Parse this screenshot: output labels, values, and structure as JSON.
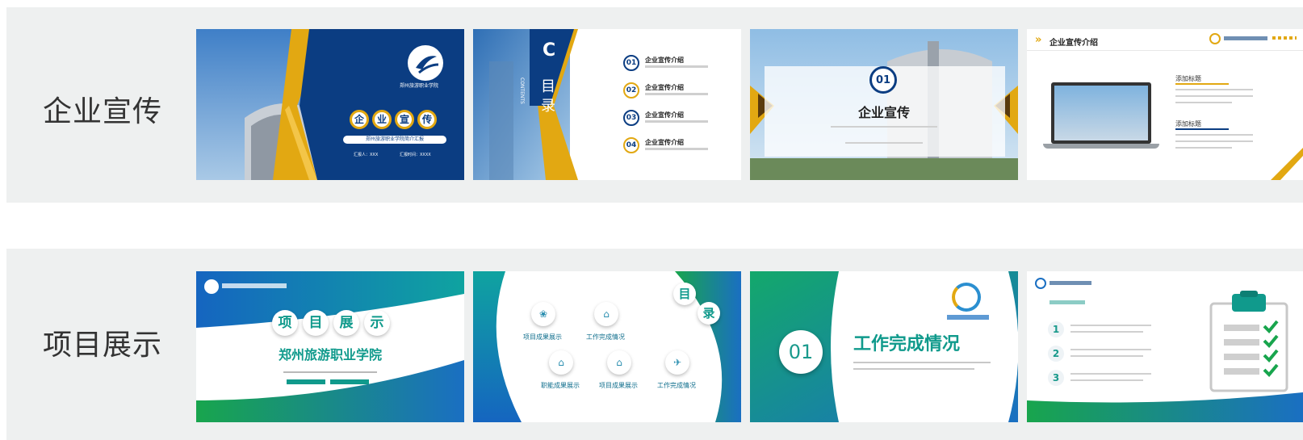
{
  "rows": [
    {
      "label": "企业宣传",
      "thumbs": {
        "t1": {
          "badge": [
            "企",
            "业",
            "宣",
            "传"
          ],
          "subtitle": "郑州旅游职业学院简介汇报",
          "reporter": "汇报人：XXX",
          "date": "汇报时间：XXXX"
        },
        "t2": {
          "side_title": "目录",
          "side_letter": "C",
          "side_word": "CONTENTS",
          "items": [
            {
              "num": "01",
              "title": "企业宣传介绍"
            },
            {
              "num": "02",
              "title": "企业宣传介绍"
            },
            {
              "num": "03",
              "title": "企业宣传介绍"
            },
            {
              "num": "04",
              "title": "企业宣传介绍"
            }
          ]
        },
        "t3": {
          "num": "01",
          "title": "企业宣传"
        },
        "t4": {
          "header": "企业宣传介绍",
          "section1": "添加标题",
          "section2": "添加标题"
        }
      }
    },
    {
      "label": "项目展示",
      "thumbs": {
        "t1": {
          "badge": [
            "项",
            "目",
            "展",
            "示"
          ],
          "title": "郑州旅游职业学院"
        },
        "t2": {
          "title_chars": [
            "目",
            "录"
          ],
          "items": [
            {
              "icon": "❀",
              "label": "项目成果展示"
            },
            {
              "icon": "⌂",
              "label": "工作完成情况"
            },
            {
              "icon": "⌂",
              "label": "职能成果展示"
            },
            {
              "icon": "⌂",
              "label": "项目成果展示"
            },
            {
              "icon": "✈",
              "label": "工作完成情况"
            }
          ]
        },
        "t3": {
          "num": "01",
          "title": "工作完成情况"
        },
        "t4": {
          "nums": [
            "1",
            "2",
            "3"
          ]
        }
      }
    }
  ],
  "colors": {
    "navy": "#0b3d82",
    "gold": "#e2a812",
    "teal": "#109a8c",
    "blue": "#1a6fc2",
    "green": "#18a54d"
  }
}
